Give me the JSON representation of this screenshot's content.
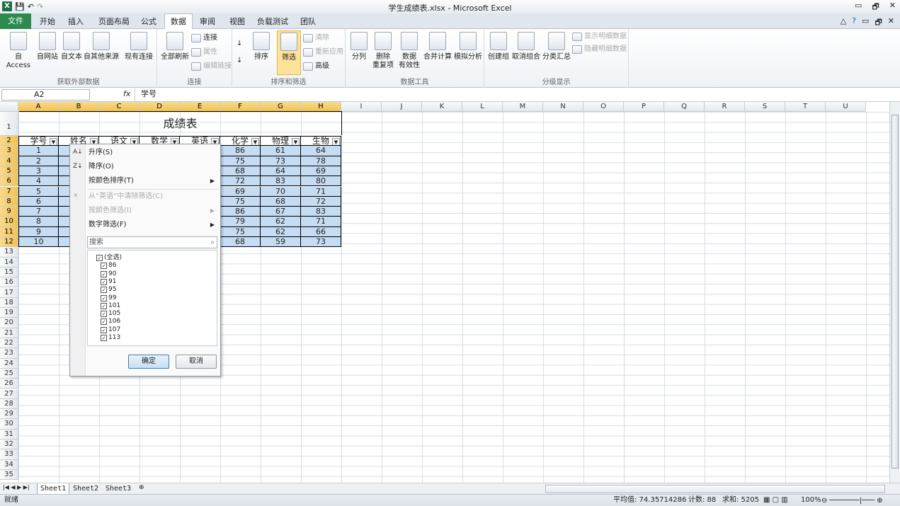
{
  "window": {
    "title": "学生成绩表.xlsx - Microsoft Excel",
    "controls": [
      "▭",
      "🗗",
      "✕"
    ]
  },
  "qat": {
    "app": "X",
    "save": "💾",
    "undo": "↶",
    "redo": "↷"
  },
  "tabs": [
    "文件",
    "开始",
    "插入",
    "页面布局",
    "公式",
    "数据",
    "审阅",
    "视图",
    "负载测试",
    "团队"
  ],
  "ribbon": {
    "groups": {
      "external": "获取外部数据",
      "conn": "连接",
      "sort": "排序和筛选",
      "tools": "数据工具",
      "outline": "分级显示"
    },
    "external": [
      "自 Access",
      "自网站",
      "自文本",
      "自其他来源",
      "现有连接"
    ],
    "conn": {
      "refresh": "全部刷新",
      "connect": "连接",
      "props": "属性",
      "edit": "编辑链接"
    },
    "sort": {
      "asc": "↓",
      "desc": "↓",
      "az": "AZ",
      "sort": "排序",
      "filter": "筛选",
      "clear": "清除",
      "reapply": "重新应用",
      "advanced": "高级"
    },
    "tools": [
      "分列",
      "删除\n重复项",
      "数据\n有效性",
      "合并计算",
      "模拟分析"
    ],
    "outline": [
      "创建组",
      "取消组合",
      "分类汇总"
    ],
    "outline_small": [
      "显示明细数据",
      "隐藏明细数据"
    ]
  },
  "formula": {
    "name": "A2",
    "value": "学号",
    "fx": "fx"
  },
  "columns": [
    "A",
    "B",
    "C",
    "D",
    "E",
    "F",
    "G",
    "H",
    "I",
    "J",
    "K",
    "L",
    "M",
    "N",
    "O",
    "P",
    "Q",
    "R",
    "S",
    "T",
    "U"
  ],
  "rows": [
    "1",
    "2",
    "3",
    "4",
    "5",
    "6",
    "7",
    "8",
    "9",
    "10",
    "11",
    "12",
    "13",
    "14",
    "15",
    "16",
    "17",
    "18",
    "19",
    "20",
    "21",
    "22",
    "23",
    "24",
    "25",
    "26",
    "27",
    "28",
    "29",
    "30",
    "31",
    "32",
    "33",
    "34",
    "35"
  ],
  "table": {
    "title": "成绩表",
    "headers": [
      "学号",
      "姓名",
      "语文",
      "数学",
      "英语",
      "化学",
      "物理",
      "生物"
    ],
    "col_a": [
      "1",
      "2",
      "3",
      "4",
      "5",
      "6",
      "7",
      "8",
      "9",
      "10"
    ],
    "col_b_partial": [
      "",
      "",
      "",
      "",
      "",
      "",
      "",
      "",
      "",
      ""
    ],
    "col_f": [
      "86",
      "75",
      "68",
      "72",
      "69",
      "75",
      "86",
      "79",
      "75",
      "68"
    ],
    "col_g": [
      "61",
      "73",
      "64",
      "83",
      "70",
      "68",
      "67",
      "62",
      "62",
      "59"
    ],
    "col_h": [
      "64",
      "78",
      "69",
      "80",
      "71",
      "72",
      "83",
      "71",
      "66",
      "73"
    ]
  },
  "filter_menu": {
    "items": [
      "升序(S)",
      "降序(O)",
      "按颜色排序(T)",
      "从“英语”中清除筛选(C)",
      "按颜色筛选(I)",
      "数字筛选(F)"
    ],
    "search": "搜索",
    "values": [
      "(全选)",
      "86",
      "90",
      "91",
      "95",
      "99",
      "101",
      "105",
      "106",
      "107",
      "113"
    ],
    "ok": "确定",
    "cancel": "取消"
  },
  "sheets": [
    "Sheet1",
    "Sheet2",
    "Sheet3"
  ],
  "status": {
    "ready": "就绪",
    "average": "平均值: 74.35714286",
    "count": "计数: 88",
    "sum": "求和: 5205",
    "zoom": "100%"
  }
}
